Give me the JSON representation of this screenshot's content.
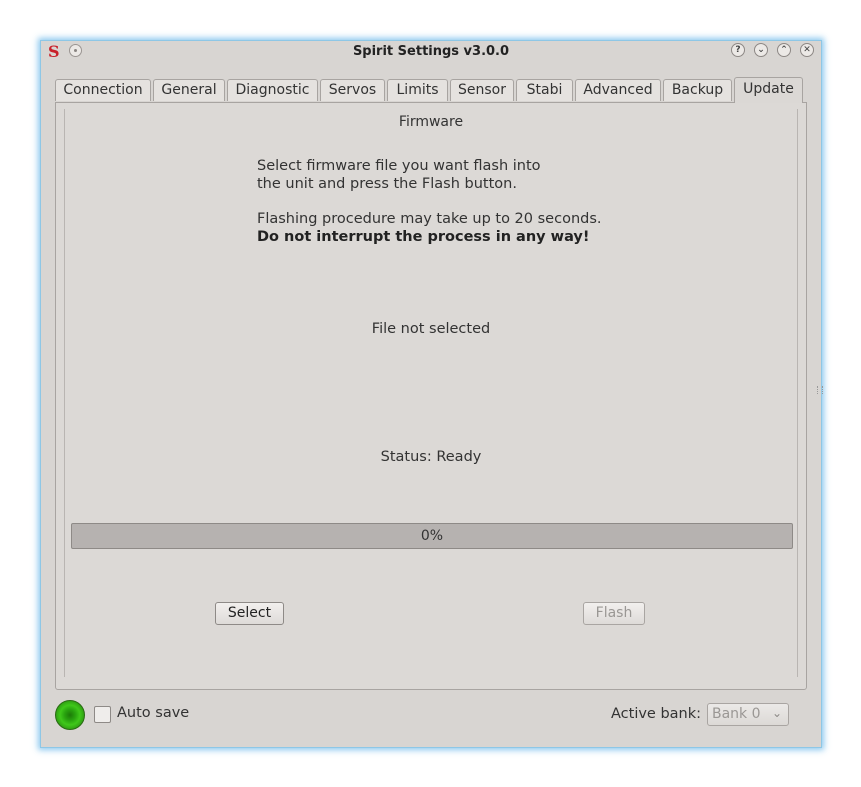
{
  "window": {
    "title": "Spirit Settings v3.0.0",
    "icon": "spirit-logo-icon",
    "controls": [
      {
        "name": "help-button",
        "glyph": "?"
      },
      {
        "name": "minimize-button",
        "glyph": "⌄"
      },
      {
        "name": "maximize-button",
        "glyph": "⌃"
      },
      {
        "name": "close-button",
        "glyph": "✕"
      }
    ]
  },
  "tabs": [
    {
      "label": "Connection"
    },
    {
      "label": "General"
    },
    {
      "label": "Diagnostic"
    },
    {
      "label": "Servos"
    },
    {
      "label": "Limits"
    },
    {
      "label": "Sensor"
    },
    {
      "label": "Stabi"
    },
    {
      "label": "Advanced"
    },
    {
      "label": "Backup"
    },
    {
      "label": "Update"
    }
  ],
  "active_tab": "Update",
  "firmware": {
    "group_title": "Firmware",
    "instructions_line1": "Select firmware file you want flash into",
    "instructions_line2": "the unit and press the Flash button.",
    "instructions_line3": "Flashing procedure may take up to 20 seconds.",
    "instructions_bold": "Do not interrupt the process in any way!",
    "file_label": "File not selected",
    "status_label": "Status: Ready",
    "progress": {
      "value": 0,
      "text": "0%"
    },
    "select_button": "Select",
    "flash_button": "Flash",
    "flash_enabled": false
  },
  "footer": {
    "connection_indicator": "green",
    "autosave_label": "Auto save",
    "autosave_checked": false,
    "active_bank_label": "Active bank:",
    "active_bank_value": "Bank 0",
    "active_bank_enabled": false
  },
  "colors": {
    "window_bg": "#d8d5d2",
    "focus_glow": "#8ec7e6",
    "led_green": "#3fc81a",
    "logo_red": "#c8202a"
  }
}
